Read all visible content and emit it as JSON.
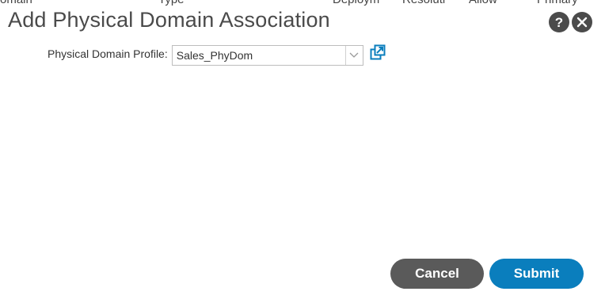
{
  "background_table": {
    "columns": [
      "omain",
      "Type",
      "Deploym",
      "Resoluti",
      "Allow",
      "Primary"
    ]
  },
  "dialog": {
    "title": "Add Physical Domain Association",
    "help_icon": "question-icon",
    "close_icon": "close-icon"
  },
  "form": {
    "physical_domain_profile": {
      "label": "Physical Domain Profile:",
      "value": "Sales_PhyDom",
      "dropdown_icon": "chevron-down-icon",
      "open_icon": "open-external-icon"
    }
  },
  "buttons": {
    "cancel_label": "Cancel",
    "submit_label": "Submit"
  },
  "colors": {
    "title_text": "#4a4a4a",
    "cancel_button": "#5a5a5a",
    "submit_button": "#0a7ebd",
    "link_icon": "#0a7ebd",
    "round_icon_bg": "#4b4b4b"
  }
}
